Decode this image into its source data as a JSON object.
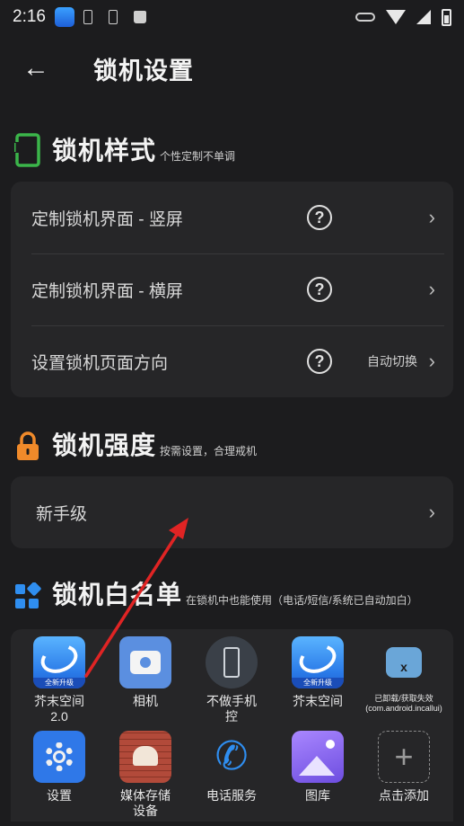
{
  "status_bar": {
    "time": "2:16"
  },
  "header": {
    "back_glyph": "←",
    "title": "锁机设置"
  },
  "style_section": {
    "title": "锁机样式",
    "subtitle": "个性定制不单调",
    "rows": [
      {
        "label": "定制锁机界面 - 竖屏",
        "value": ""
      },
      {
        "label": "定制锁机界面 - 横屏",
        "value": ""
      },
      {
        "label": "设置锁机页面方向",
        "value": "自动切换"
      }
    ]
  },
  "strength_section": {
    "title": "锁机强度",
    "subtitle": "按需设置，合理戒机",
    "level_label": "新手级"
  },
  "whitelist_section": {
    "title": "锁机白名单",
    "subtitle": "在锁机中也能使用（电话/短信/系统已自动加白）",
    "apps": [
      {
        "label": "芥末空间\n2.0",
        "icon": "jiemo-icon",
        "icon_tag": "全新升级"
      },
      {
        "label": "相机",
        "icon": "camera-icon"
      },
      {
        "label": "不做手机\n控",
        "icon": "phone-icon"
      },
      {
        "label": "芥末空间",
        "icon": "jiemo-icon",
        "icon_tag": "全新升级"
      },
      {
        "label": "已卸载/获取失效(com.android.incallui)",
        "icon": "android-icon"
      },
      {
        "label": "设置",
        "icon": "settings-icon"
      },
      {
        "label": "媒体存储\n设备",
        "icon": "media-storage-icon"
      },
      {
        "label": "电话服务",
        "icon": "call-icon"
      },
      {
        "label": "图库",
        "icon": "gallery-icon"
      },
      {
        "label": "点击添加",
        "icon": "add-icon"
      }
    ]
  },
  "glyphs": {
    "help": "?",
    "chevron": "›",
    "plus": "+"
  },
  "colors": {
    "background": "#1c1c1e",
    "card": "#262628",
    "accent_green": "#3bb54a",
    "accent_orange": "#f08a2a",
    "accent_blue": "#2f8ef0",
    "arrow": "#e02424"
  }
}
